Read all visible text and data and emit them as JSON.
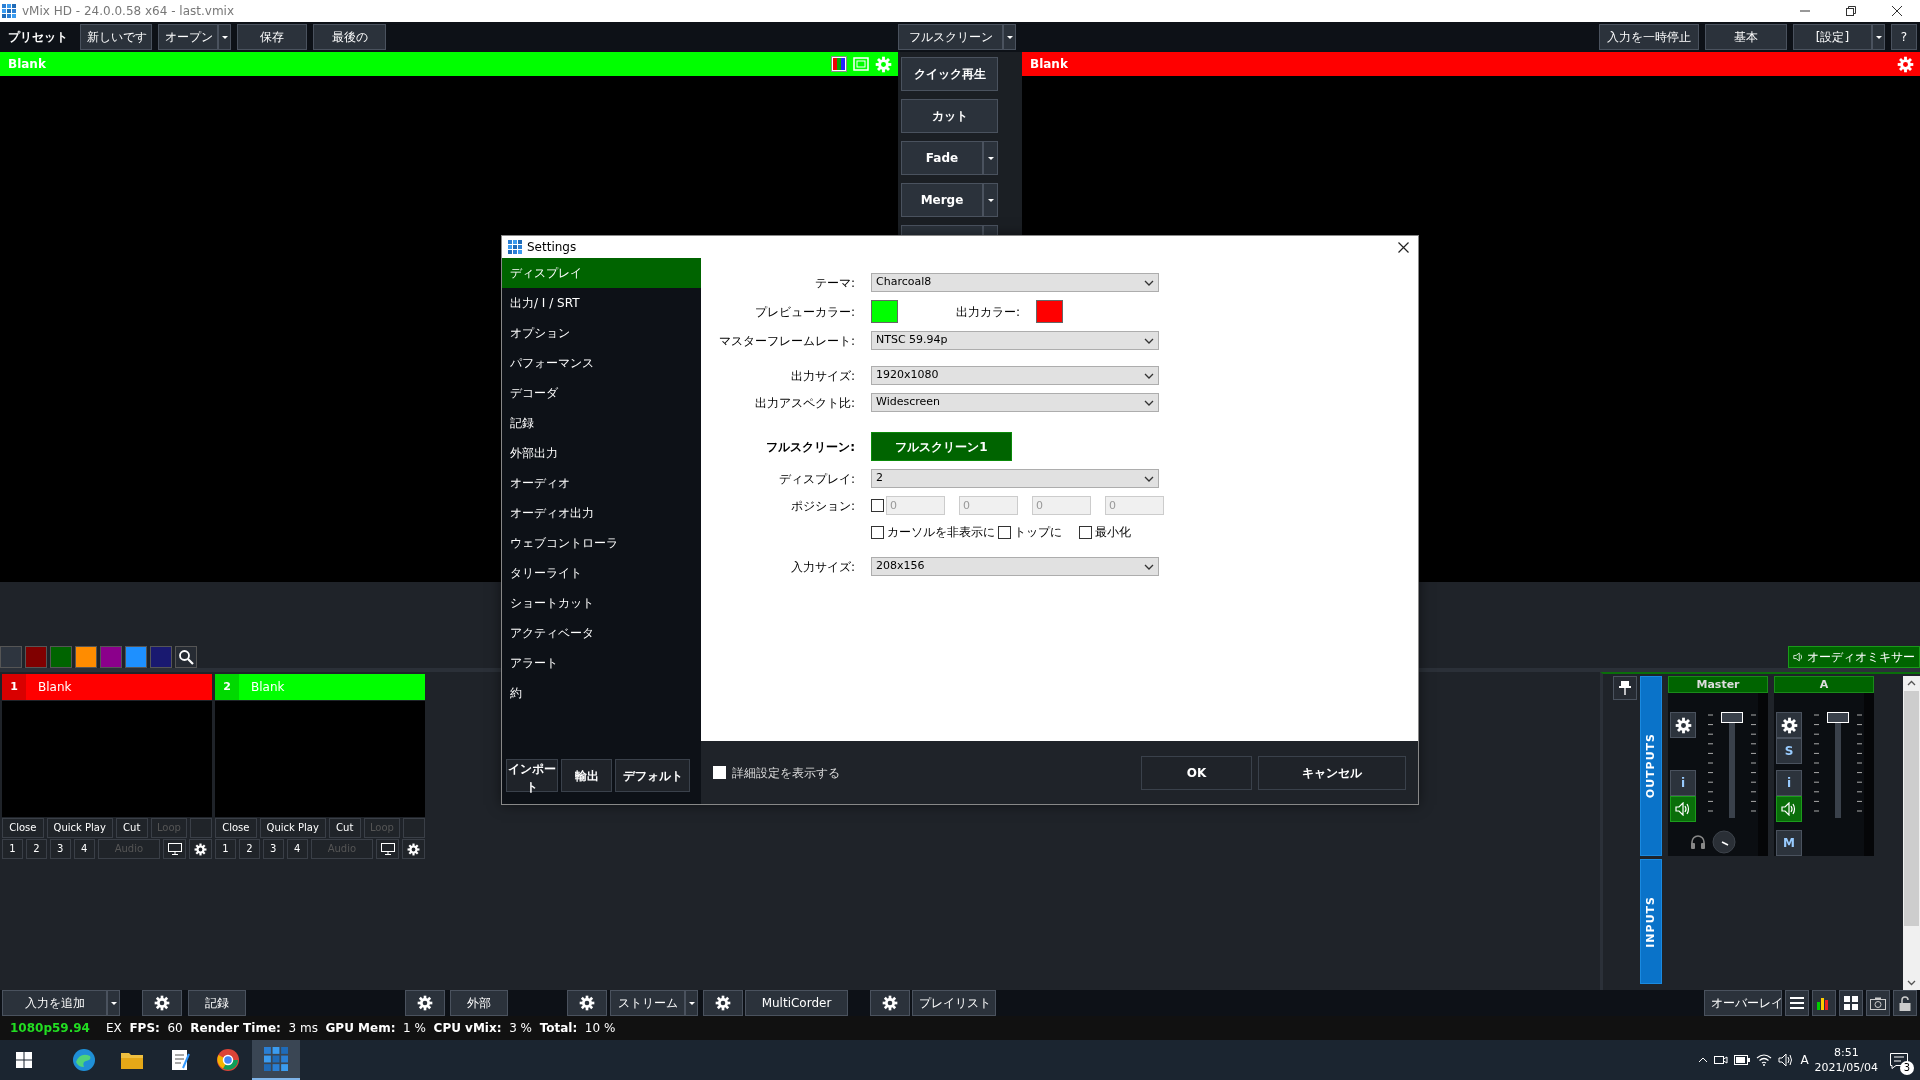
{
  "window": {
    "title": "vMix HD - 24.0.0.58 x64 - last.vmix"
  },
  "top_bar": {
    "left": [
      {
        "kind": "text",
        "label": "プリセット"
      },
      {
        "kind": "button",
        "label": "新しいです"
      },
      {
        "kind": "split",
        "label": "オープン"
      },
      {
        "kind": "button",
        "label": "保存"
      },
      {
        "kind": "button",
        "label": "最後の"
      }
    ],
    "center": [
      {
        "kind": "split",
        "label": "フルスクリーン"
      }
    ],
    "right": [
      {
        "kind": "button",
        "label": "入力を一時停止"
      },
      {
        "kind": "button",
        "label": "基本"
      },
      {
        "kind": "split",
        "label": "[設定]"
      },
      {
        "kind": "button",
        "label": "?"
      }
    ]
  },
  "preview": {
    "title": "Blank",
    "color": "#00ff00"
  },
  "transitions": [
    {
      "kind": "button",
      "label": "クイック再生"
    },
    {
      "kind": "button",
      "label": "カット"
    },
    {
      "kind": "split",
      "label": "Fade"
    },
    {
      "kind": "split",
      "label": "Merge"
    },
    {
      "kind": "split"
    }
  ],
  "output": {
    "title": "Blank",
    "color": "#ff0000"
  },
  "color_filters": [
    {
      "color": "#2e353f"
    },
    {
      "color": "#800000"
    },
    {
      "color": "#006400"
    },
    {
      "color": "#ff8c00"
    },
    {
      "color": "#8b008b"
    },
    {
      "color": "#1e90ff"
    },
    {
      "color": "#191970"
    }
  ],
  "audio_mixer_button": {
    "label": "オーディオミキサー"
  },
  "inputs": [
    {
      "number": "1",
      "title": "Blank",
      "color": "#ff0000",
      "controls": [
        {
          "label": "Close",
          "disabled": false
        },
        {
          "label": "Quick Play",
          "disabled": false
        },
        {
          "label": "Cut",
          "disabled": false
        },
        {
          "label": "Loop",
          "disabled": true
        }
      ],
      "buses": [
        "1",
        "2",
        "3",
        "4"
      ],
      "audio": {
        "label": "Audio",
        "disabled": true
      }
    },
    {
      "number": "2",
      "title": "Blank",
      "color": "#00ff00",
      "controls": [
        {
          "label": "Close",
          "disabled": false
        },
        {
          "label": "Quick Play",
          "disabled": false
        },
        {
          "label": "Cut",
          "disabled": false
        },
        {
          "label": "Loop",
          "disabled": true
        }
      ],
      "buses": [
        "1",
        "2",
        "3",
        "4"
      ],
      "audio": {
        "label": "Audio",
        "disabled": true
      }
    }
  ],
  "mixer": {
    "tabs": [
      "OUTPUTS",
      "INPUTS"
    ],
    "strips": [
      {
        "name": "Master",
        "level": 1,
        "top_buttons": [
          {
            "kind": "gear"
          }
        ],
        "bottom_buttons": [
          {
            "kind": "text",
            "label": "i"
          },
          {
            "kind": "speaker",
            "on": true
          }
        ],
        "footer": [
          {
            "kind": "headphones"
          },
          {
            "kind": "knob"
          }
        ]
      },
      {
        "name": "A",
        "level": 1,
        "top_buttons": [
          {
            "kind": "gear"
          },
          {
            "kind": "text",
            "label": "S"
          }
        ],
        "bottom_buttons": [
          {
            "kind": "text",
            "label": "i"
          },
          {
            "kind": "speaker",
            "on": true
          }
        ],
        "footer": [
          {
            "kind": "text",
            "label": "M"
          }
        ]
      }
    ]
  },
  "bottom_toolbar": {
    "items": [
      {
        "kind": "split",
        "label": "入力を追加"
      },
      {
        "kind": "gear"
      },
      {
        "kind": "button",
        "label": "記録"
      },
      {
        "kind": "gear"
      },
      {
        "kind": "button",
        "label": "外部"
      },
      {
        "kind": "gear"
      },
      {
        "kind": "split",
        "label": "ストリーム"
      },
      {
        "kind": "gear"
      },
      {
        "kind": "button",
        "label": "MultiCorder"
      },
      {
        "kind": "gear"
      },
      {
        "kind": "button",
        "label": "プレイリスト"
      }
    ],
    "right": [
      {
        "kind": "button",
        "label": "オーバーレイ"
      },
      {
        "kind": "list"
      },
      {
        "kind": "meter"
      },
      {
        "kind": "grid"
      },
      {
        "kind": "camera"
      },
      {
        "kind": "lock"
      }
    ]
  },
  "status_bar": {
    "format": "1080p59.94",
    "stats": "EX  **FPS:**  60  **Render Time:**  3 ms  **GPU Mem:**  1 %  **CPU vMix:**  3 %  **Total:**  10 %"
  },
  "settings": {
    "title": "Settings",
    "nav": [
      {
        "label": "ディスプレイ",
        "selected": true
      },
      {
        "label": "出力/ I / SRT",
        "selected": false
      },
      {
        "label": "オプション",
        "selected": false
      },
      {
        "label": "パフォーマンス",
        "selected": false
      },
      {
        "label": "デコーダ",
        "selected": false
      },
      {
        "label": "記録",
        "selected": false
      },
      {
        "label": "外部出力",
        "selected": false
      },
      {
        "label": "オーディオ",
        "selected": false
      },
      {
        "label": "オーディオ出力",
        "selected": false
      },
      {
        "label": "ウェブコントローラ",
        "selected": false
      },
      {
        "label": "タリーライト",
        "selected": false
      },
      {
        "label": "ショートカット",
        "selected": false
      },
      {
        "label": "アクティベータ",
        "selected": false
      },
      {
        "label": "アラート",
        "selected": false
      },
      {
        "label": "約",
        "selected": false
      }
    ],
    "nav_buttons": [
      "インポート",
      "輸出",
      "デフォルト"
    ],
    "sections": [
      [
        {
          "kind": "select",
          "label": "テーマ:",
          "value": "Charcoal8"
        },
        {
          "kind": "colors",
          "swatches": [
            {
              "label": "プレビューカラー:",
              "color": "#00ff00"
            },
            {
              "label": "出力カラー:",
              "color": "#ff0000"
            }
          ]
        },
        {
          "kind": "select",
          "label": "マスターフレームレート:",
          "value": "NTSC 59.94p"
        }
      ],
      [
        {
          "kind": "select",
          "label": "出力サイズ:",
          "value": "1920x1080"
        },
        {
          "kind": "select",
          "label": "出力アスペクト比:",
          "value": "Widescreen"
        }
      ],
      [
        {
          "kind": "button",
          "label": "フルスクリーン:",
          "button": "フルスクリーン1"
        },
        {
          "kind": "select",
          "label": "ディスプレイ:",
          "value": "2"
        },
        {
          "kind": "position",
          "label": "ポジション:",
          "checked": false,
          "fields": [
            {
              "value": "0",
              "disabled": true
            },
            {
              "value": "0",
              "disabled": true
            },
            {
              "value": "0",
              "disabled": true
            },
            {
              "value": "0",
              "disabled": true
            }
          ]
        },
        {
          "kind": "checks",
          "items": [
            {
              "label": "カーソルを非表示に",
              "checked": false
            },
            {
              "label": "トップに",
              "checked": false
            },
            {
              "label": "最小化",
              "checked": false
            }
          ]
        }
      ],
      [
        {
          "kind": "select",
          "label": "入力サイズ:",
          "value": "208x156"
        }
      ]
    ],
    "advanced": {
      "label": "詳細設定を表示する",
      "checked": false
    },
    "buttons": [
      "OK",
      "キャンセル"
    ]
  },
  "taskbar": {
    "apps": [
      {
        "kind": "start",
        "selected": false
      },
      {
        "kind": "browser-wave",
        "selected": false
      },
      {
        "kind": "folder",
        "selected": false
      },
      {
        "kind": "notepad",
        "selected": false
      },
      {
        "kind": "browser-round",
        "selected": false
      },
      {
        "kind": "grid-app",
        "selected": true
      }
    ],
    "ime": "A",
    "time": "8:51",
    "date": "2021/05/04",
    "notifications": "3"
  }
}
